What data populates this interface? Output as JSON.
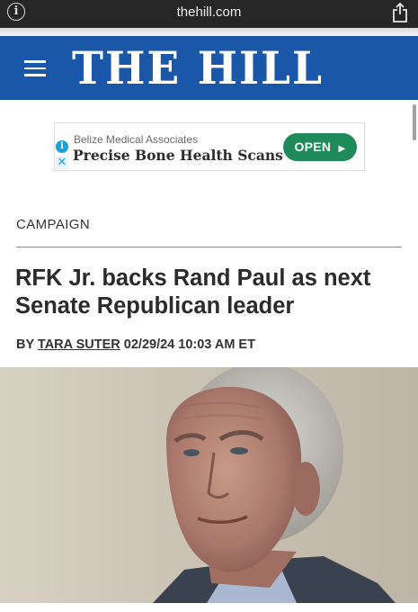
{
  "browser": {
    "url": "thehill.com",
    "info_icon": "info-icon",
    "share_icon": "share-icon"
  },
  "masthead": {
    "logo_text": "THE HILL",
    "menu_icon": "hamburger-menu-icon",
    "background_color": "#1a57a8"
  },
  "ad": {
    "sponsor": "Belize Medical Associates",
    "headline": "Precise Bone Health Scans",
    "cta_label": "OPEN",
    "cta_color": "#1f8a5a",
    "info_icon": "ad-info-icon",
    "close_icon": "ad-close-icon"
  },
  "article": {
    "section": "CAMPAIGN",
    "headline": "RFK Jr. backs Rand Paul as next Senate Republican leader",
    "byline_prefix": "BY",
    "author": "TARA SUTER",
    "timestamp": "02/29/24 10:03 AM ET"
  }
}
